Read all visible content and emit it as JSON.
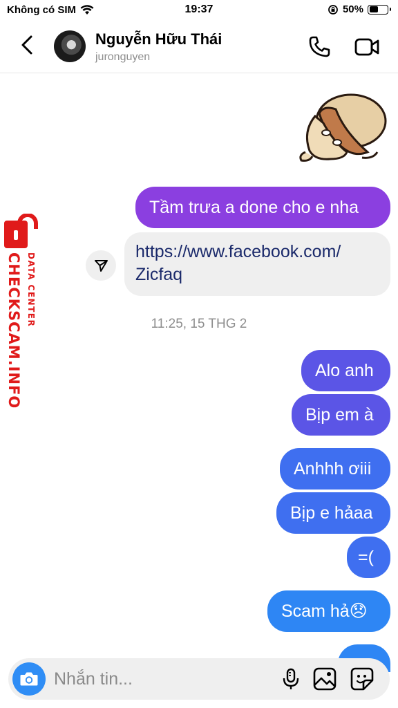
{
  "status_bar": {
    "carrier": "Không có SIM",
    "time": "19:37",
    "battery_percent": "50%",
    "battery_level": 0.5,
    "icons": [
      "wifi-icon",
      "orientation-lock-icon",
      "battery-icon"
    ]
  },
  "header": {
    "name": "Nguyễn Hữu Thái",
    "username": "juronguyen",
    "icons": [
      "back-chevron-icon",
      "phone-icon",
      "video-camera-icon"
    ]
  },
  "messages": [
    {
      "side": "right",
      "type": "sticker",
      "sticker_name": "mushroom-sticker"
    },
    {
      "side": "right",
      "type": "text",
      "text": "Tầm trưa a done cho e nha"
    },
    {
      "side": "left",
      "type": "link",
      "text": "https://www.facebook.com/\nZicfaq",
      "line1": "https://www.facebook.com/",
      "line2": "Zicfaq"
    },
    {
      "type": "timestamp",
      "text": "11:25, 15 THG 2"
    },
    {
      "side": "right",
      "type": "text",
      "text": "Alo anh"
    },
    {
      "side": "right",
      "type": "text",
      "text": "Bịp em à"
    },
    {
      "side": "right",
      "type": "text",
      "text": "Anhhh ơiii"
    },
    {
      "side": "right",
      "type": "text",
      "text": "Bịp e hảaa"
    },
    {
      "side": "right",
      "type": "text",
      "text": "=("
    },
    {
      "side": "right",
      "type": "text",
      "text": "Scam hả😞"
    }
  ],
  "watermark": {
    "main": "CHECKSCAM.INFO",
    "sub": "DATA CENTER",
    "color": "#e01a1a"
  },
  "composer": {
    "placeholder": "Nhắn tin...",
    "icons": [
      "camera-icon",
      "microphone-icon",
      "gallery-icon",
      "sticker-icon"
    ]
  },
  "colors": {
    "bubble_purple": "#8b3fe0",
    "bubble_indigo": "#5b55e6",
    "bubble_blue": "#3f6ff0",
    "bubble_sky": "#2e86f4",
    "camera_button": "#2f8df5"
  }
}
